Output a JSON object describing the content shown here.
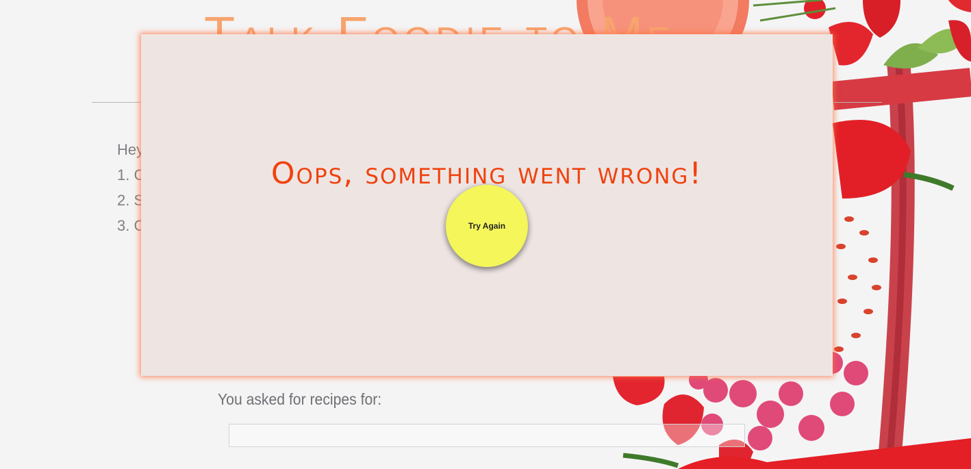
{
  "header": {
    "title": "Talk Foodie to Me"
  },
  "instructions": {
    "items": [
      "Hey",
      "1. C",
      "2. S",
      "3. C"
    ]
  },
  "results": {
    "asked_label": "You asked for recipes for:",
    "query_value": ""
  },
  "error_modal": {
    "message": "Oops, something went wrong!",
    "retry_label": "Try Again"
  },
  "colors": {
    "modal_bg": "#eee5e3",
    "error_text": "#f0420e",
    "button_bg": "#f4f65a",
    "title_text": "#f7a46e"
  }
}
